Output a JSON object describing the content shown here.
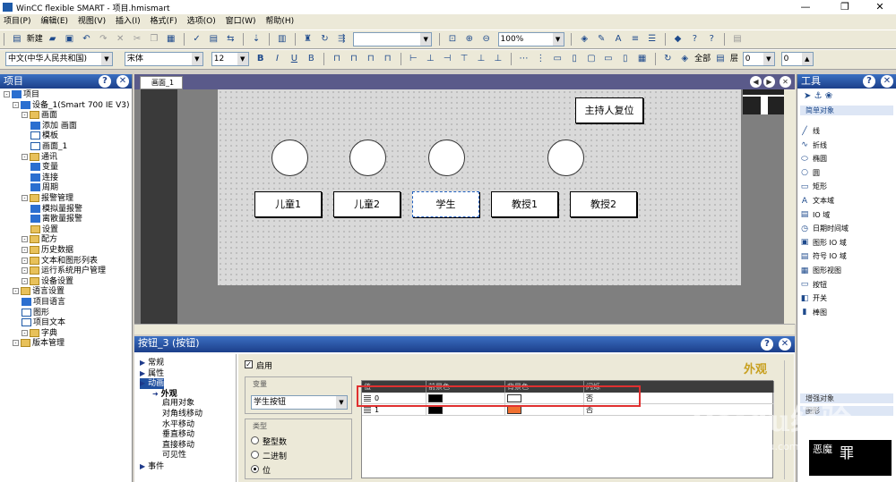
{
  "window": {
    "title": "WinCC flexible SMART - 项目.hmismart",
    "min": "—",
    "restore": "❐",
    "close": "✕"
  },
  "menu": [
    "项目(P)",
    "编辑(E)",
    "视图(V)",
    "插入(I)",
    "格式(F)",
    "选项(O)",
    "窗口(W)",
    "帮助(H)"
  ],
  "toolbar1": {
    "new_label": "新建",
    "zoom_value": "100%"
  },
  "toolbar2": {
    "language": "中文(中华人民共和国)",
    "font": "宋体",
    "font_size": "12",
    "all_label": "全部",
    "layer_label": "层",
    "layer_value": "0",
    "z_value": "0"
  },
  "project_panel": {
    "title": "项目",
    "items": [
      {
        "label": "项目",
        "indent": 0,
        "icon": "project-icon"
      },
      {
        "label": "设备_1(Smart 700 IE V3)",
        "indent": 1,
        "icon": "device-icon"
      },
      {
        "label": "画面",
        "indent": 2,
        "icon": "folder-icon"
      },
      {
        "label": "添加 画面",
        "indent": 3,
        "icon": "add-screen-icon"
      },
      {
        "label": "模板",
        "indent": 3,
        "icon": "template-icon"
      },
      {
        "label": "画面_1",
        "indent": 3,
        "icon": "screen-icon"
      },
      {
        "label": "通讯",
        "indent": 2,
        "icon": "folder-icon"
      },
      {
        "label": "变量",
        "indent": 3,
        "icon": "tags-icon"
      },
      {
        "label": "连接",
        "indent": 3,
        "icon": "connection-icon"
      },
      {
        "label": "周期",
        "indent": 3,
        "icon": "cycle-icon"
      },
      {
        "label": "报警管理",
        "indent": 2,
        "icon": "folder-icon"
      },
      {
        "label": "模拟量报警",
        "indent": 3,
        "icon": "analog-alarm-icon"
      },
      {
        "label": "离散量报警",
        "indent": 3,
        "icon": "discrete-alarm-icon"
      },
      {
        "label": "设置",
        "indent": 3,
        "icon": "settings-icon"
      },
      {
        "label": "配方",
        "indent": 2,
        "icon": "folder-icon"
      },
      {
        "label": "历史数据",
        "indent": 2,
        "icon": "folder-icon"
      },
      {
        "label": "文本和图形列表",
        "indent": 2,
        "icon": "folder-icon"
      },
      {
        "label": "运行系统用户管理",
        "indent": 2,
        "icon": "folder-icon"
      },
      {
        "label": "设备设置",
        "indent": 2,
        "icon": "folder-icon"
      },
      {
        "label": "语言设置",
        "indent": 1,
        "icon": "folder-icon"
      },
      {
        "label": "项目语言",
        "indent": 2,
        "icon": "language-icon"
      },
      {
        "label": "图形",
        "indent": 2,
        "icon": "graphics-icon"
      },
      {
        "label": "项目文本",
        "indent": 2,
        "icon": "text-icon"
      },
      {
        "label": "字典",
        "indent": 2,
        "icon": "folder-icon"
      },
      {
        "label": "版本管理",
        "indent": 1,
        "icon": "folder-icon"
      }
    ]
  },
  "editor": {
    "tab_label": "画面_1",
    "buttons": [
      "儿童1",
      "儿童2",
      "学生",
      "教授1",
      "教授2"
    ],
    "reset_button": "主持人复位"
  },
  "properties": {
    "title": "按钮_3 (按钮)",
    "nav": [
      {
        "label": "常规",
        "level": 0
      },
      {
        "label": "属性",
        "level": 0
      },
      {
        "label": "动画",
        "level": 0
      },
      {
        "label": "外观",
        "level": 1
      },
      {
        "label": "启用对象",
        "level": 1
      },
      {
        "label": "对角线移动",
        "level": 1
      },
      {
        "label": "水平移动",
        "level": 1
      },
      {
        "label": "垂直移动",
        "level": 1
      },
      {
        "label": "直接移动",
        "level": 1
      },
      {
        "label": "可见性",
        "level": 1
      },
      {
        "label": "事件",
        "level": 0
      }
    ],
    "enable_label": "启用",
    "section_title": "外观",
    "variable_group": "变量",
    "variable_value": "学生按钮",
    "type_group": "类型",
    "type_options": [
      "整型数",
      "二进制",
      "位"
    ],
    "bit_value": "0",
    "table": {
      "columns": [
        "值",
        "前景色",
        "背景色",
        "闪烁"
      ],
      "rows": [
        {
          "value": "0",
          "fg": "#000000",
          "bg": "#ffffff",
          "blink": "否"
        },
        {
          "value": "1",
          "fg": "#000000",
          "bg": "#f07030",
          "blink": "否"
        }
      ]
    }
  },
  "tools_panel": {
    "title": "工具",
    "section": "简单对象",
    "items": [
      {
        "label": "线",
        "icon": "line-icon"
      },
      {
        "label": "折线",
        "icon": "polyline-icon"
      },
      {
        "label": "椭圆",
        "icon": "ellipse-icon"
      },
      {
        "label": "圆",
        "icon": "circle-icon"
      },
      {
        "label": "矩形",
        "icon": "rectangle-icon"
      },
      {
        "label": "文本域",
        "icon": "text-field-icon"
      },
      {
        "label": "IO 域",
        "icon": "io-field-icon"
      },
      {
        "label": "日期时间域",
        "icon": "datetime-icon"
      },
      {
        "label": "图形 IO 域",
        "icon": "graphic-io-icon"
      },
      {
        "label": "符号 IO 域",
        "icon": "symbolic-io-icon"
      },
      {
        "label": "图形视图",
        "icon": "graphic-view-icon"
      },
      {
        "label": "按钮",
        "icon": "button-icon"
      },
      {
        "label": "开关",
        "icon": "switch-icon"
      },
      {
        "label": "棒图",
        "icon": "bar-icon"
      }
    ],
    "section2": "增强对象",
    "section3": "图形"
  },
  "watermark": {
    "main": "Baidu经验",
    "sub": "jingyan.baidu.com"
  },
  "logo_text": [
    "恶魔",
    "罪"
  ]
}
